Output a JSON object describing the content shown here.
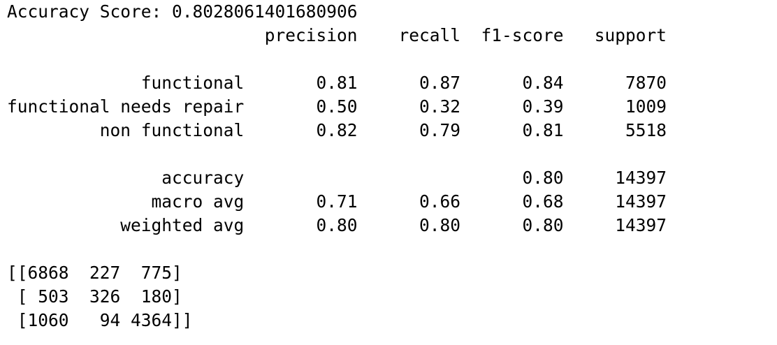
{
  "output": {
    "accuracy_line": "Accuracy Score: 0.8028061401680906",
    "report_header": "                         precision    recall  f1-score   support",
    "blank": "",
    "report_rows": [
      "             functional       0.81      0.87      0.84      7870",
      "functional needs repair       0.50      0.32      0.39      1009",
      "         non functional       0.82      0.79      0.81      5518"
    ],
    "summary_rows": [
      "               accuracy                           0.80     14397",
      "              macro avg       0.71      0.66      0.68     14397",
      "           weighted avg       0.80      0.80      0.80     14397"
    ],
    "confusion_matrix": [
      "[[6868  227  775]",
      " [ 503  326  180]",
      " [1060   94 4364]]"
    ]
  }
}
